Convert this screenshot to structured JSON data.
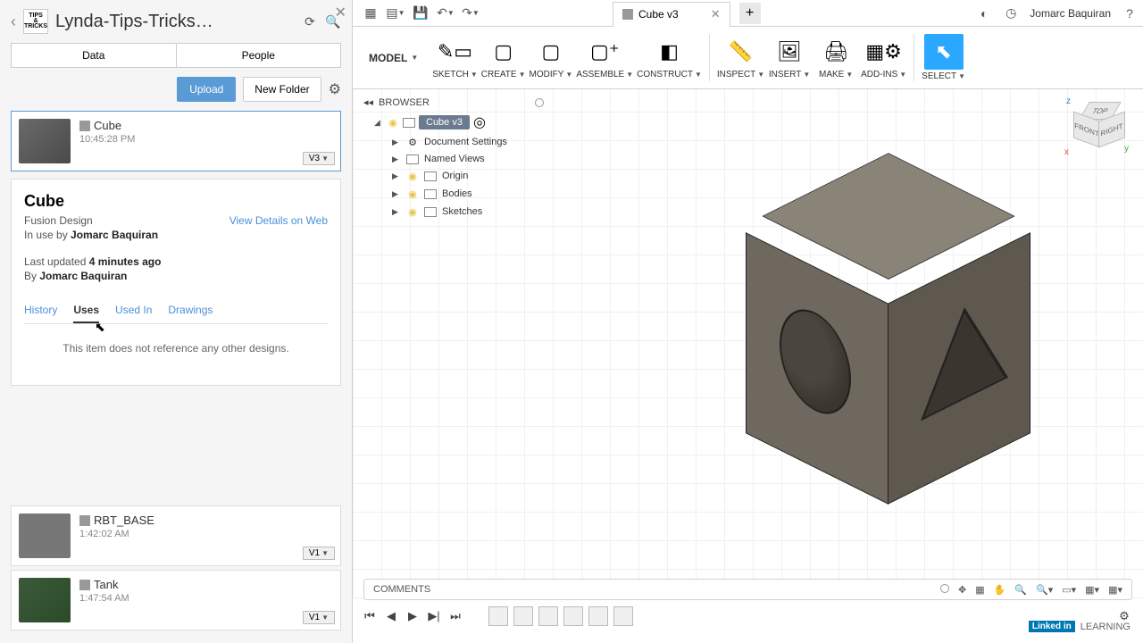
{
  "app_bar": {
    "tab_title": "Cube v3",
    "user": "Jomarc Baquiran"
  },
  "panel": {
    "project_title": "Lynda-Tips-Tricks…",
    "tabs": {
      "data": "Data",
      "people": "People"
    },
    "upload": "Upload",
    "new_folder": "New Folder"
  },
  "selected_item": {
    "name": "Cube",
    "time": "10:45:28 PM",
    "version": "V3"
  },
  "details": {
    "title": "Cube",
    "type": "Fusion Design",
    "view_web": "View Details on Web",
    "in_use_prefix": "In use by ",
    "in_use_by": "Jomarc Baquiran",
    "updated_prefix": "Last updated ",
    "updated_value": "4 minutes ago",
    "by_prefix": "By ",
    "by_value": "Jomarc Baquiran",
    "tabs": {
      "history": "History",
      "uses": "Uses",
      "used_in": "Used In",
      "drawings": "Drawings"
    },
    "content": "This item does not reference any other designs."
  },
  "other_items": [
    {
      "name": "RBT_BASE",
      "time": "1:42:02 AM",
      "version": "V1"
    },
    {
      "name": "Tank",
      "time": "1:47:54 AM",
      "version": "V1"
    }
  ],
  "ribbon": {
    "workspace": "MODEL",
    "groups": [
      "SKETCH",
      "CREATE",
      "MODIFY",
      "ASSEMBLE",
      "CONSTRUCT",
      "INSPECT",
      "INSERT",
      "MAKE",
      "ADD-INS",
      "SELECT"
    ]
  },
  "browser": {
    "title": "BROWSER",
    "root": "Cube v3",
    "items": [
      "Document Settings",
      "Named Views",
      "Origin",
      "Bodies",
      "Sketches"
    ]
  },
  "viewcube": {
    "top": "TOP",
    "front": "FRONT",
    "right": "RIGHT"
  },
  "comments": "COMMENTS",
  "footer": {
    "linkedin": "Linked in",
    "learning": "LEARNING"
  }
}
